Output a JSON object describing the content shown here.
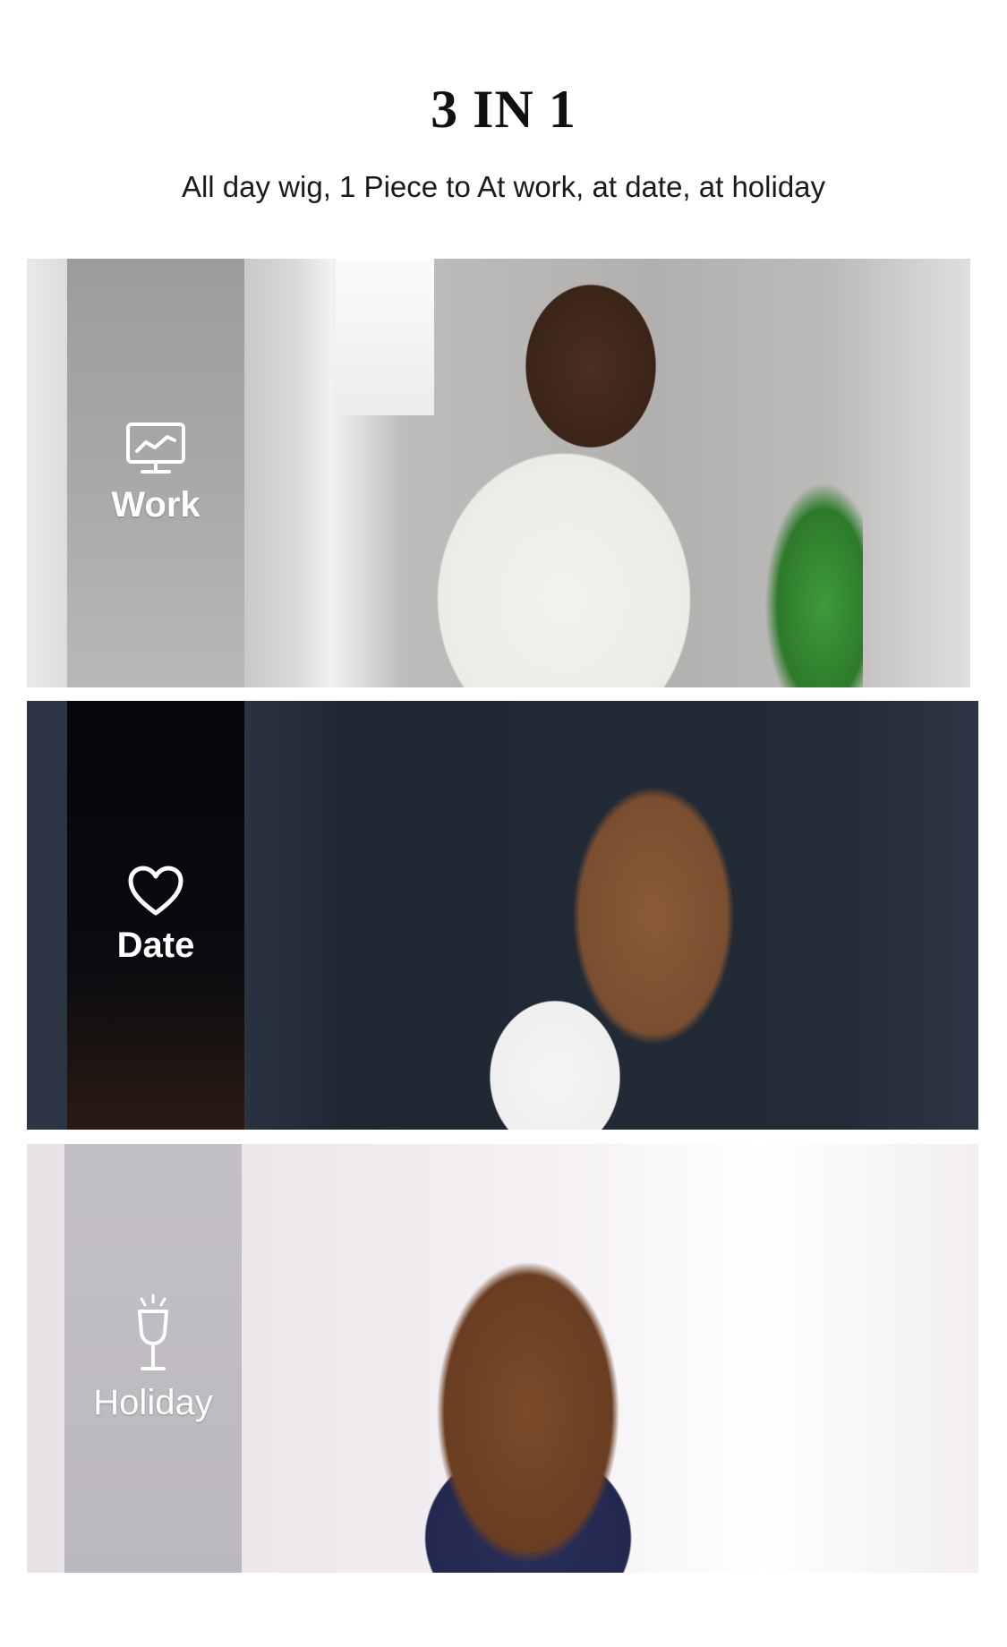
{
  "header": {
    "title": "3 IN 1",
    "subtitle": "All day wig, 1 Piece to At work, at date, at holiday"
  },
  "panels": [
    {
      "label": "Work",
      "icon": "monitor-chart-icon"
    },
    {
      "label": "Date",
      "icon": "heart-icon"
    },
    {
      "label": "Holiday",
      "icon": "wine-glass-icon"
    }
  ]
}
